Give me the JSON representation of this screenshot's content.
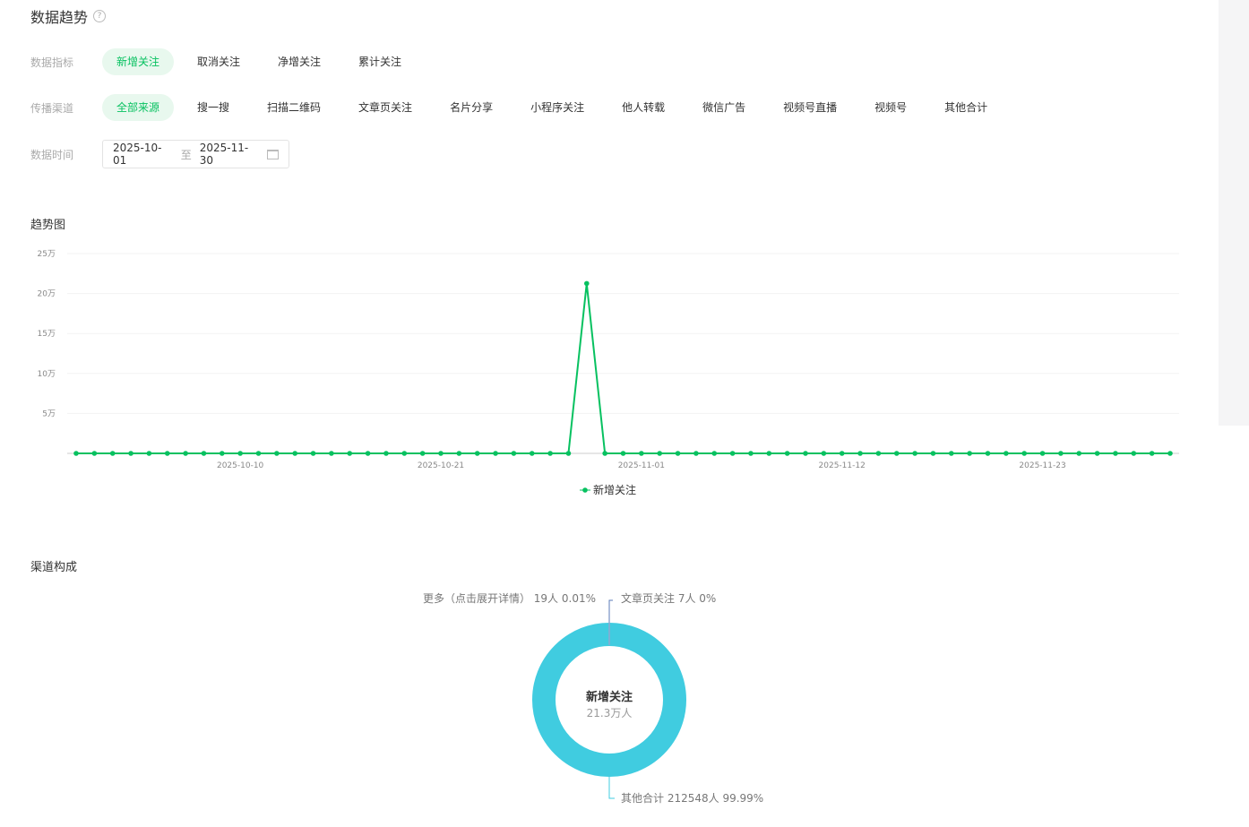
{
  "title": "数据趋势",
  "help_icon": "?",
  "metric": {
    "label": "数据指标",
    "options": [
      "新增关注",
      "取消关注",
      "净增关注",
      "累计关注"
    ],
    "active": 0
  },
  "channel": {
    "label": "传播渠道",
    "options": [
      "全部来源",
      "搜一搜",
      "扫描二维码",
      "文章页关注",
      "名片分享",
      "小程序关注",
      "他人转载",
      "微信广告",
      "视频号直播",
      "视频号",
      "其他合计"
    ],
    "active": 0
  },
  "time": {
    "label": "数据时间",
    "start": "2025-10-01",
    "sep": "至",
    "end": "2025-11-30"
  },
  "trend_title": "趋势图",
  "compose_title": "渠道构成",
  "colors": {
    "accent": "#07c160",
    "donut": "#40cce0"
  },
  "chart_data": [
    {
      "type": "line",
      "title": "趋势图",
      "start_date": "2025-10-01",
      "days": 61,
      "xticks": [
        "2025-10-10",
        "2025-10-21",
        "2025-11-01",
        "2025-11-12",
        "2025-11-23"
      ],
      "xtick_index": [
        9,
        20,
        31,
        42,
        53
      ],
      "yticks": [
        "5万",
        "10万",
        "15万",
        "20万",
        "25万"
      ],
      "ytick_values": [
        50000,
        100000,
        150000,
        200000,
        250000
      ],
      "ylim": [
        0,
        250000
      ],
      "series": [
        {
          "name": "新增关注",
          "values": [
            0,
            0,
            0,
            0,
            0,
            0,
            0,
            0,
            0,
            0,
            0,
            0,
            0,
            0,
            0,
            0,
            0,
            0,
            0,
            0,
            0,
            0,
            0,
            0,
            0,
            0,
            0,
            0,
            212574,
            0,
            0,
            0,
            0,
            0,
            0,
            0,
            0,
            0,
            0,
            0,
            0,
            0,
            0,
            0,
            0,
            0,
            0,
            0,
            0,
            0,
            0,
            0,
            0,
            0,
            0,
            0,
            0,
            0,
            0,
            0,
            0
          ]
        }
      ],
      "legend": "bottom"
    },
    {
      "type": "pie",
      "title": "渠道构成",
      "center_title": "新增关注",
      "center_value": "21.3万人",
      "slices": [
        {
          "name": "其他合计",
          "label": "其他合计 212548人 99.99%",
          "value": 212548
        },
        {
          "name": "更多（点击展开详情）",
          "label": "更多（点击展开详情） 19人 0.01%",
          "value": 19
        },
        {
          "name": "文章页关注",
          "label": "文章页关注 7人 0%",
          "value": 7
        }
      ]
    }
  ]
}
